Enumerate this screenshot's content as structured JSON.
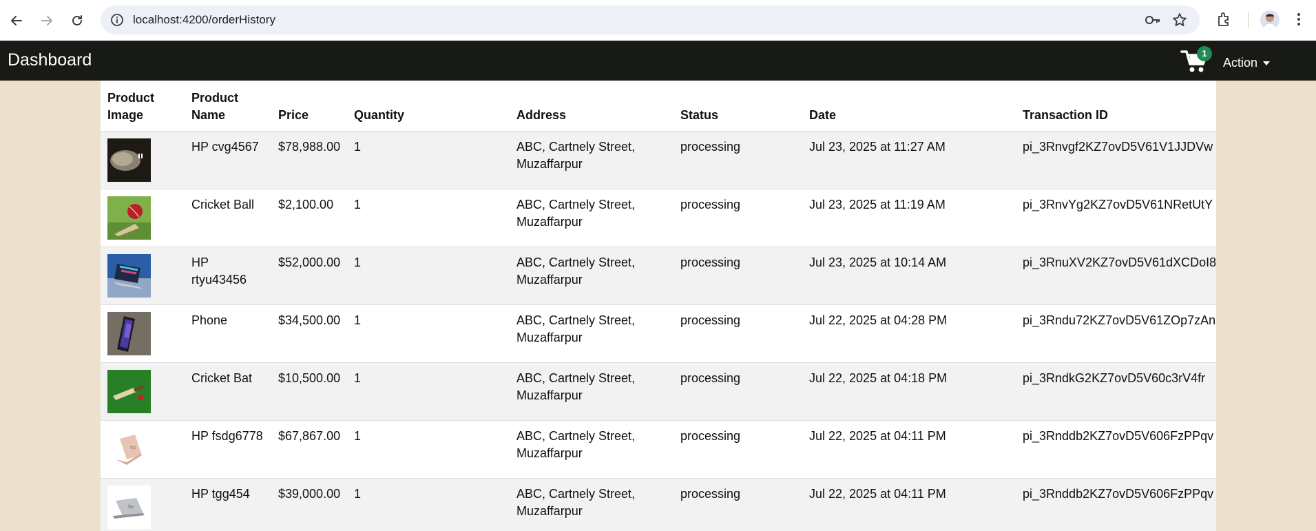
{
  "browser": {
    "url": "localhost:4200/orderHistory",
    "icons": [
      "back-arrow-icon",
      "forward-arrow-icon",
      "reload-icon",
      "site-info-icon",
      "password-key-icon",
      "bookmark-star-icon",
      "extensions-icon",
      "profile-avatar",
      "more-menu-icon"
    ]
  },
  "navbar": {
    "brand": "Dashboard",
    "cart_count": "1",
    "action_label": "Action"
  },
  "table": {
    "headers": {
      "image": "Product Image",
      "name": "Product Name",
      "price": "Price",
      "quantity": "Quantity",
      "address": "Address",
      "status": "Status",
      "date": "Date",
      "transaction": "Transaction ID"
    },
    "rows": [
      {
        "image_icon": "golf-club-image",
        "name": "HP cvg4567",
        "price": "$78,988.00",
        "quantity": "1",
        "address": "ABC, Cartnely Street, Muzaffarpur",
        "status": "processing",
        "date": "Jul 23, 2025 at 11:27 AM",
        "transaction": "pi_3Rnvgf2KZ7ovD5V61V1JJDVw"
      },
      {
        "image_icon": "cricket-ball-image",
        "name": "Cricket Ball",
        "price": "$2,100.00",
        "quantity": "1",
        "address": "ABC, Cartnely Street, Muzaffarpur",
        "status": "processing",
        "date": "Jul 23, 2025 at 11:19 AM",
        "transaction": "pi_3RnvYg2KZ7ovD5V61NRetUtY"
      },
      {
        "image_icon": "laptop-image",
        "name": "HP rtyu43456",
        "price": "$52,000.00",
        "quantity": "1",
        "address": "ABC, Cartnely Street, Muzaffarpur",
        "status": "processing",
        "date": "Jul 23, 2025 at 10:14 AM",
        "transaction": "pi_3RnuXV2KZ7ovD5V61dXCDoI8"
      },
      {
        "image_icon": "phone-image",
        "name": "Phone",
        "price": "$34,500.00",
        "quantity": "1",
        "address": "ABC, Cartnely Street, Muzaffarpur",
        "status": "processing",
        "date": "Jul 22, 2025 at 04:28 PM",
        "transaction": "pi_3Rndu72KZ7ovD5V61ZOp7zAn"
      },
      {
        "image_icon": "cricket-bat-image",
        "name": "Cricket Bat",
        "price": "$10,500.00",
        "quantity": "1",
        "address": "ABC, Cartnely Street, Muzaffarpur",
        "status": "processing",
        "date": "Jul 22, 2025 at 04:18 PM",
        "transaction": "pi_3RndkG2KZ7ovD5V60c3rV4fr"
      },
      {
        "image_icon": "laptop-rose-image",
        "name": "HP fsdg6778",
        "price": "$67,867.00",
        "quantity": "1",
        "address": "ABC, Cartnely Street, Muzaffarpur",
        "status": "processing",
        "date": "Jul 22, 2025 at 04:11 PM",
        "transaction": "pi_3Rnddb2KZ7ovD5V606FzPPqv"
      },
      {
        "image_icon": "laptop-silver-image",
        "name": "HP tgg454",
        "price": "$39,000.00",
        "quantity": "1",
        "address": "ABC, Cartnely Street, Muzaffarpur",
        "status": "processing",
        "date": "Jul 22, 2025 at 04:11 PM",
        "transaction": "pi_3Rnddb2KZ7ovD5V606FzPPqv"
      }
    ]
  }
}
